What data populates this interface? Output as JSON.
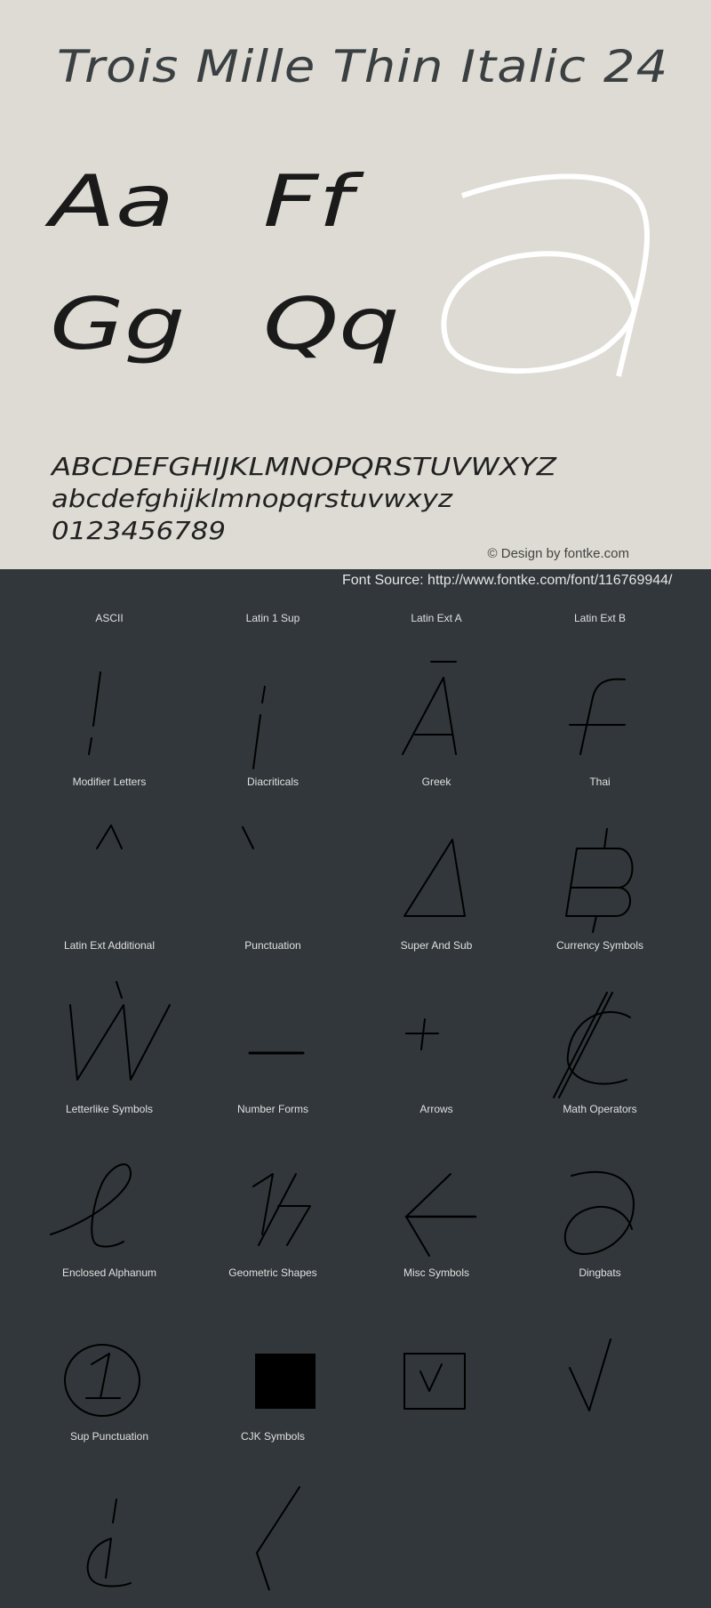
{
  "header": {
    "title": "Trois Mille Thin Italic 24"
  },
  "samples": {
    "pairs": [
      "Aa",
      "Ff",
      "Gg",
      "Qq"
    ],
    "hero_glyph": "a",
    "uppercase": "ABCDEFGHIJKLMNOPQRSTUVWXYZ",
    "lowercase": "abcdefghijklmnopqrstuvwxyz",
    "digits": "0123456789"
  },
  "credit": "© Design by fontke.com",
  "source": "Font Source: http://www.fontke.com/font/116769944/",
  "colors": {
    "top_background": "#dddbd3",
    "bottom_background": "#31373a",
    "hero_glyph": "#ffffff",
    "glyph": "#000000",
    "label": "#e0e0e0"
  },
  "blocks": [
    {
      "label": "ASCII",
      "glyph": "!",
      "icon": "exclamation-glyph"
    },
    {
      "label": "Latin 1 Sup",
      "glyph": "¡",
      "icon": "inverted-exclamation-glyph"
    },
    {
      "label": "Latin Ext A",
      "glyph": "Ā",
      "icon": "a-macron-glyph"
    },
    {
      "label": "Latin Ext B",
      "glyph": "ƒ",
      "icon": "f-hook-glyph"
    },
    {
      "label": "Modifier Letters",
      "glyph": "ˆ",
      "icon": "circumflex-glyph"
    },
    {
      "label": "Diacriticals",
      "glyph": "̀",
      "icon": "grave-accent-glyph"
    },
    {
      "label": "Greek",
      "glyph": "Δ",
      "icon": "delta-glyph"
    },
    {
      "label": "Thai",
      "glyph": "฿",
      "icon": "baht-glyph"
    },
    {
      "label": "Latin Ext Additional",
      "glyph": "Ẁ",
      "icon": "w-grave-glyph"
    },
    {
      "label": "Punctuation",
      "glyph": "–",
      "icon": "en-dash-glyph"
    },
    {
      "label": "Super And Sub",
      "glyph": "⁺",
      "icon": "superscript-plus-glyph"
    },
    {
      "label": "Currency Symbols",
      "glyph": "₡",
      "icon": "colon-sign-glyph"
    },
    {
      "label": "Letterlike Symbols",
      "glyph": "ℓ",
      "icon": "script-l-glyph"
    },
    {
      "label": "Number Forms",
      "glyph": "⅐",
      "icon": "one-seventh-glyph"
    },
    {
      "label": "Arrows",
      "glyph": "←",
      "icon": "left-arrow-glyph"
    },
    {
      "label": "Math Operators",
      "glyph": "∂",
      "icon": "partial-differential-glyph"
    },
    {
      "label": "Enclosed Alphanum",
      "glyph": "①",
      "icon": "circled-one-glyph"
    },
    {
      "label": "Geometric Shapes",
      "glyph": "■",
      "icon": "black-square-glyph"
    },
    {
      "label": "Misc Symbols",
      "glyph": "☑",
      "icon": "ballot-box-check-glyph"
    },
    {
      "label": "Dingbats",
      "glyph": "✓",
      "icon": "check-mark-glyph"
    },
    {
      "label": "Sup Punctuation",
      "glyph": "⸘",
      "icon": "inverted-interrobang-glyph"
    },
    {
      "label": "CJK Symbols",
      "glyph": "〈",
      "icon": "left-angle-bracket-glyph"
    }
  ]
}
